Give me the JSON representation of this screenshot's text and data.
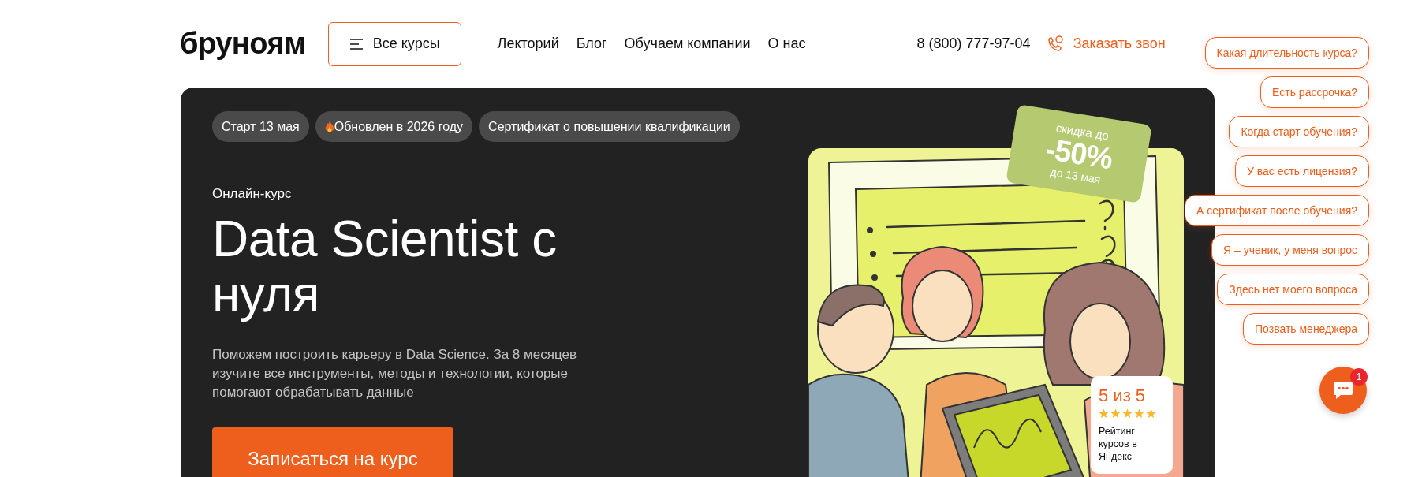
{
  "header": {
    "logo": "бруноям",
    "catalog_button": "Все курсы",
    "nav": [
      "Лекторий",
      "Блог",
      "Обучаем компании",
      "О нас"
    ],
    "phone": "8 (800) 777-97-04",
    "callback": "Заказать звон"
  },
  "hero": {
    "tags": [
      {
        "kind": "plain",
        "label": "Старт 13 мая"
      },
      {
        "kind": "fire",
        "label": "Обновлен в 2026 году"
      },
      {
        "kind": "plain",
        "label": "Сертификат о повышении квалификации"
      }
    ],
    "eyebrow": "Онлайн-курс",
    "title": "Data Scientist с нуля",
    "description": "Поможем построить карьеру в Data Science. За 8 месяцев изучите все инструменты, методы и технологии, которые помогают обрабатывать данные",
    "cta": "Записаться на курс",
    "discount": {
      "top": "скидка до",
      "value": "-50%",
      "bottom": "до 13 мая"
    },
    "rating": {
      "score": "5 из 5",
      "stars": 5,
      "caption": "Рейтинг курсов в Яндекс"
    }
  },
  "chat": {
    "quick_replies": [
      "Какая длительность курса?",
      "Есть рассрочка?",
      "Когда старт обучения?",
      "У вас есть лицензия?",
      "А сертификат после обучения?",
      "Я – ученик, у меня вопрос",
      "Здесь нет моего вопроса",
      "Позвать менеджера"
    ],
    "badge": "1"
  }
}
